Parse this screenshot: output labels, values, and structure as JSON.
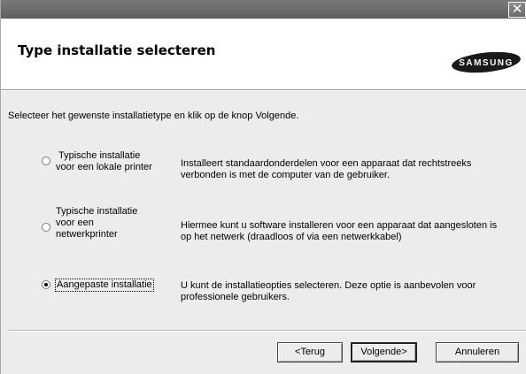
{
  "window": {
    "close_icon": "close-icon"
  },
  "header": {
    "title": "Type installatie selecteren",
    "logo_text": "SAMSUNG"
  },
  "instruction": "Selecteer het gewenste installatietype en klik op de knop Volgende.",
  "options": [
    {
      "label_lines": [
        "Typische installatie",
        "voor een lokale printer"
      ],
      "description_lines": [
        "Installeert standaardonderdelen voor een apparaat dat rechtstreeks",
        "verbonden is met de computer van de gebruiker."
      ],
      "selected": false
    },
    {
      "label_lines": [
        "Typische installatie",
        "voor een",
        "netwerkprinter"
      ],
      "description_lines": [
        "Hiermee kunt u software installeren voor een apparaat dat aangesloten is",
        "op het netwerk (draadloos of via een netwerkkabel)"
      ],
      "selected": false
    },
    {
      "label_lines": [
        "Aangepaste installatie"
      ],
      "description_lines": [
        "U kunt de installatieopties selecteren. Deze optie is aanbevolen voor",
        "professionele gebruikers."
      ],
      "selected": true
    }
  ],
  "buttons": {
    "back": "<Terug",
    "next": "Volgende>",
    "cancel": "Annuleren"
  }
}
